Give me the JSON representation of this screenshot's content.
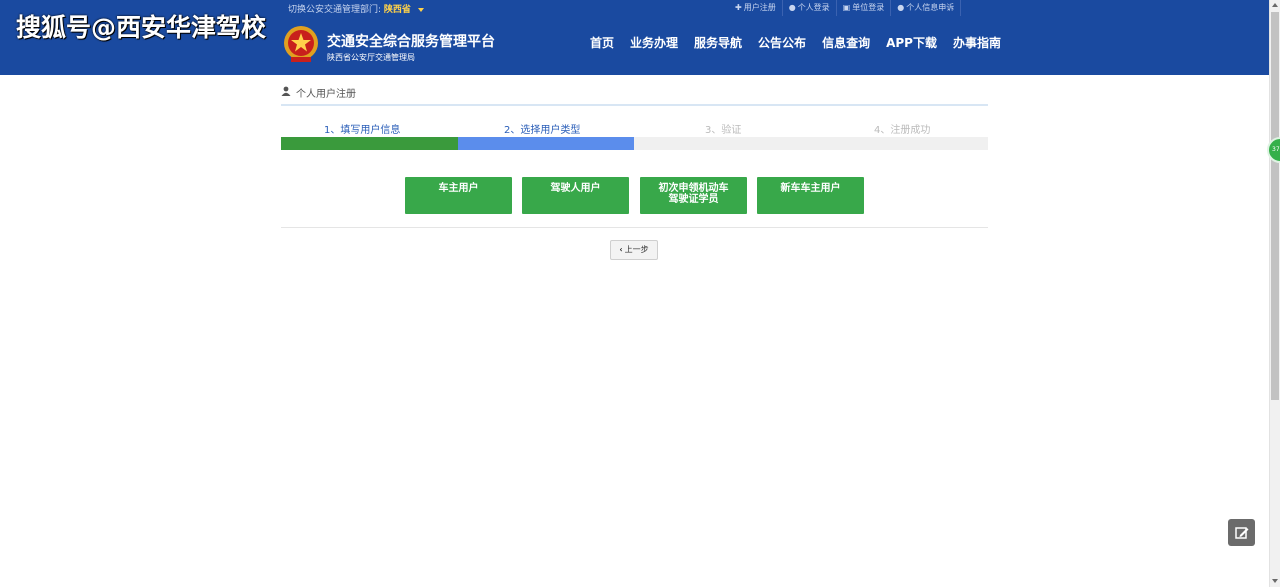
{
  "watermark": "搜狐号@西安华津驾校",
  "topbar": {
    "region_label": "切换公安交通管理部门:",
    "region_value": "陕西省",
    "links": [
      {
        "icon": "plus-icon",
        "label": "用户注册"
      },
      {
        "icon": "user-icon",
        "label": "个人登录"
      },
      {
        "icon": "building-icon",
        "label": "单位登录"
      },
      {
        "icon": "user-icon",
        "label": "个人信息申诉"
      }
    ]
  },
  "header": {
    "title": "交通安全综合服务管理平台",
    "subtitle": "陕西省公安厅交通管理局",
    "nav": [
      "首页",
      "业务办理",
      "服务导航",
      "公告公布",
      "信息查询",
      "APP下载",
      "办事指南"
    ]
  },
  "breadcrumb": "个人用户注册",
  "steps": [
    {
      "label": "1、填写用户信息",
      "state": "done"
    },
    {
      "label": "2、选择用户类型",
      "state": "active"
    },
    {
      "label": "3、验证",
      "state": "pending"
    },
    {
      "label": "4、注册成功",
      "state": "pending"
    }
  ],
  "progress_fraction": 0.5,
  "user_types": [
    [
      "车主用户"
    ],
    [
      "驾驶人用户"
    ],
    [
      "初次申领机动车",
      "驾驶证学员"
    ],
    [
      "新车车主用户"
    ]
  ],
  "prev_button": "上一步",
  "float_badge": "37",
  "colors": {
    "header_bg": "#1a4aa0",
    "step_done": "#3a9a3c",
    "step_active": "#5b8dec",
    "button_green": "#38a84a",
    "region_highlight": "#ffd24a"
  }
}
